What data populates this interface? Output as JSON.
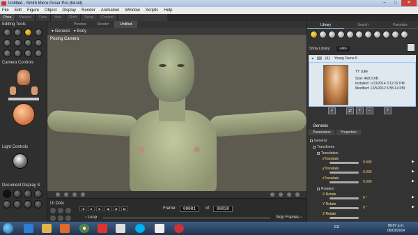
{
  "window": {
    "title": "Untitled - Smith Micro Poser Pro (64-bit)",
    "min": "–",
    "max": "□",
    "close": "✕"
  },
  "menu": [
    "File",
    "Edit",
    "Figure",
    "Object",
    "Display",
    "Render",
    "Animation",
    "Window",
    "Scripts",
    "Help"
  ],
  "room_tabs": [
    "Pose",
    "Material",
    "Face",
    "Hair",
    "Cloth",
    "Setup",
    "Content"
  ],
  "left": {
    "editing_tools": "Editing Tools",
    "camera_controls": "Camera Controls",
    "light_controls": "Light Controls",
    "document_display": "Document Display S"
  },
  "viewport": {
    "tabs": [
      "Preview",
      "Render",
      "Untitled"
    ],
    "figure_menu": "Genesis",
    "part_menu": "Body",
    "camera_label": "Posing Camera"
  },
  "animation": {
    "ui_dots": "UI Dots",
    "frame_label": "Frame:",
    "current_frame": "00001",
    "of_label": "of",
    "total_frames": "00030",
    "loop_label": "Loop",
    "skip_label": "Skip Frames"
  },
  "library": {
    "tabs": [
      "Library",
      "Search",
      "Favorites"
    ],
    "show_label": "Show Library:",
    "filter": "<All>",
    "path_tag": "[4]",
    "path_name": "Young Teens 5",
    "item": {
      "name": "YT Julie",
      "size": "Size: 468.5 KB",
      "installed": "Installed: 1/13/2014 3:12:32 PM",
      "modified": "Modified: 12/5/2012 6:55:14 PM"
    }
  },
  "params": {
    "title": "Genesis",
    "tabs": [
      "Parameters",
      "Properties"
    ],
    "groups": [
      "General",
      "Transforms",
      "Translation",
      "Rotation"
    ],
    "translation": [
      {
        "label": "xTranslate",
        "value": "0.000"
      },
      {
        "label": "yTranslate",
        "value": "0.000"
      },
      {
        "label": "zTranslate",
        "value": "0.000"
      }
    ],
    "rotation": [
      {
        "label": "X Rotate",
        "value": "0 °"
      },
      {
        "label": "Y Rotate",
        "value": "0 °"
      },
      {
        "label": "Z Rotate",
        "value": ""
      }
    ]
  },
  "taskbar": {
    "language": "ES",
    "time": "06:07 p.m.",
    "date": "06/03/2014"
  },
  "colors": {
    "accent": "#ffcc00",
    "viewport_bg": "#5d5a4f",
    "figure": "#b9c19a"
  }
}
